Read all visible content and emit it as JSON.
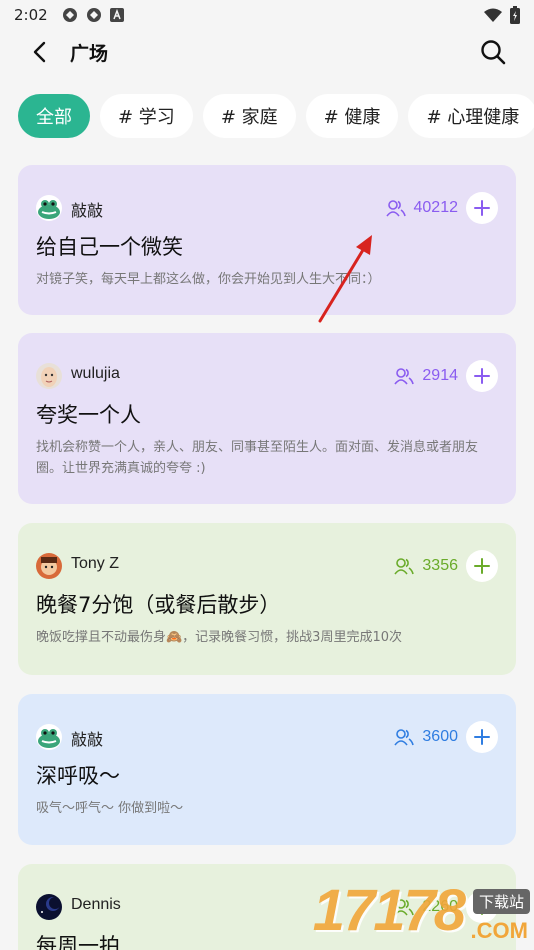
{
  "status_bar": {
    "time": "2:02"
  },
  "header": {
    "title": "广场"
  },
  "tags": [
    "全部",
    "# 学习",
    "# 家庭",
    "# 健康",
    "# 心理健康"
  ],
  "cards": [
    {
      "author": "敲敲",
      "count": "40212",
      "title": "给自己一个微笑",
      "desc": "对镜子笑，每天早上都这么做，你会开始见到人生大不同：）",
      "accent": "#8a5cf0"
    },
    {
      "author": "wulujia",
      "count": "2914",
      "title": "夸奖一个人",
      "desc": "找机会称赞一个人，亲人、朋友、同事甚至陌生人。面对面、发消息或者朋友圈。让世界充满真诚的夸夸 :)",
      "accent": "#8a5cf0"
    },
    {
      "author": "Tony Z",
      "count": "3356",
      "title": "晚餐7分饱（或餐后散步）",
      "desc": "晚饭吃撑且不动最伤身🙈，记录晚餐习惯，挑战3周里完成10次",
      "accent": "#6aab2a"
    },
    {
      "author": "敲敲",
      "count": "3600",
      "title": "深呼吸～",
      "desc": "吸气～呼气～ 你做到啦～",
      "accent": "#2f7de1"
    },
    {
      "author": "Dennis",
      "count": "2260",
      "title": "每周一拍",
      "desc": "",
      "accent": "#6aab2a"
    }
  ],
  "watermark": {
    "number": "17178",
    "label": "下载站",
    "suffix": ".COM"
  }
}
